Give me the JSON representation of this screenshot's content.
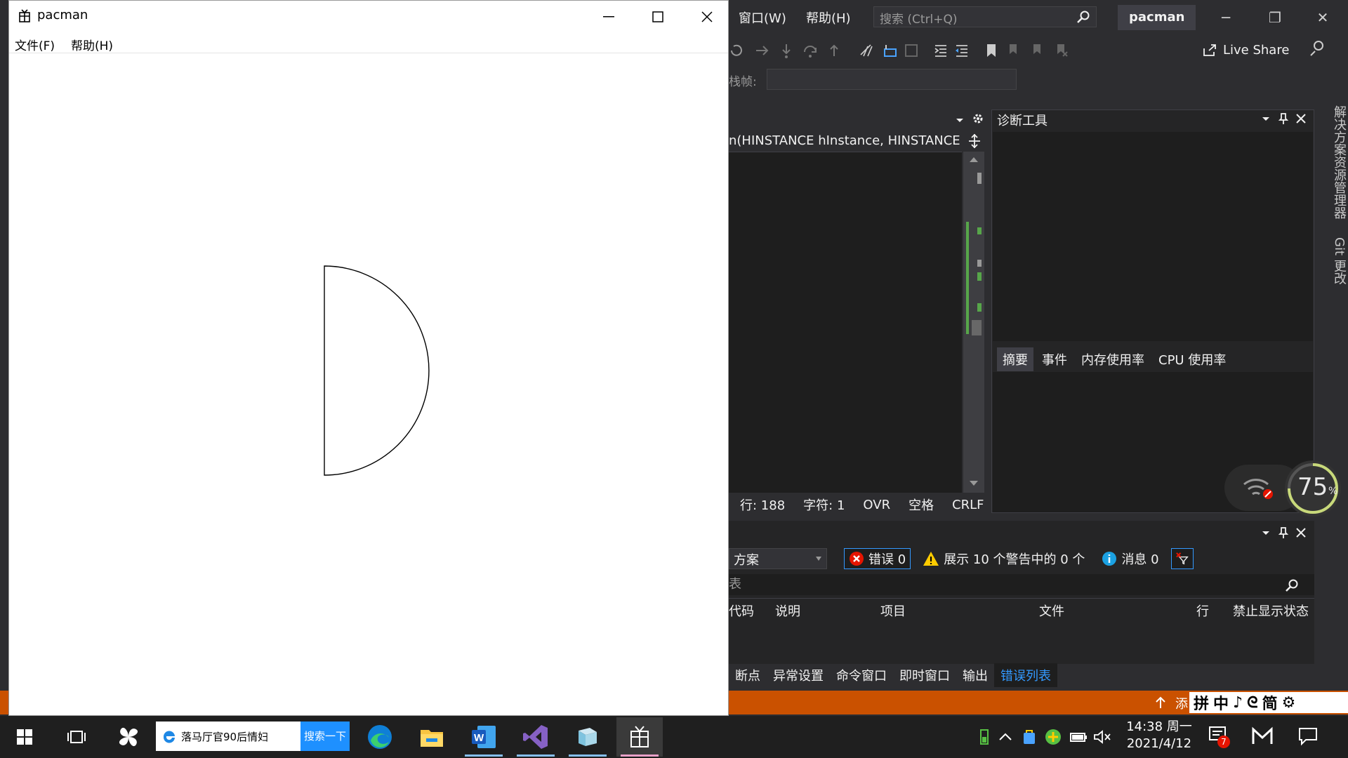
{
  "vs": {
    "menu": {
      "window": "窗口(W)",
      "help": "帮助(H)"
    },
    "search_placeholder": "搜索 (Ctrl+Q)",
    "solution_name": "pacman",
    "live_share": "Live Share",
    "stack_frame_label": "栈帧:",
    "editor_nav": "n(HINSTANCE hInstance, HINSTANCE",
    "status": {
      "line": "行: 188",
      "char": "字符: 1",
      "ovr": "OVR",
      "space": "空格",
      "crlf": "CRLF"
    },
    "side_tabs": [
      "解决方案资源管理器",
      "Git 更改"
    ],
    "diagnostics": {
      "title": "诊断工具",
      "tabs": [
        "摘要",
        "事件",
        "内存使用率",
        "CPU 使用率"
      ]
    },
    "error_list": {
      "scope": "方案",
      "errors": "错误 0",
      "warnings": "展示 10 个警告中的 0 个",
      "messages": "消息 0",
      "search_label": "表",
      "columns": [
        "代码",
        "说明",
        "项目",
        "文件",
        "行",
        "禁止显示状态"
      ]
    },
    "bottom_tabs": [
      "断点",
      "异常设置",
      "命令窗口",
      "即时窗口",
      "输出",
      "错误列表"
    ],
    "active_bottom_tab": "错误列表",
    "statusbar_add": "添",
    "ime": {
      "chars": [
        "拼",
        "中",
        "♪",
        "ᘓ",
        "简",
        "⚙"
      ]
    },
    "perf_percent": "75",
    "perf_unit": "%"
  },
  "pacman": {
    "title": "pacman",
    "menu": {
      "file": "文件(F)",
      "help": "帮助(H)"
    }
  },
  "taskbar": {
    "search_text": "落马厅官90后情妇",
    "search_button": "搜索一下",
    "time": "14:38 周一",
    "date": "2021/4/12",
    "notification_count": "7"
  },
  "colors": {
    "vs_bg": "#2d2d30",
    "accent": "#3399ff",
    "statusbar": "#ca5100",
    "error_red": "#e51400",
    "warning_yellow": "#ffcc00"
  }
}
